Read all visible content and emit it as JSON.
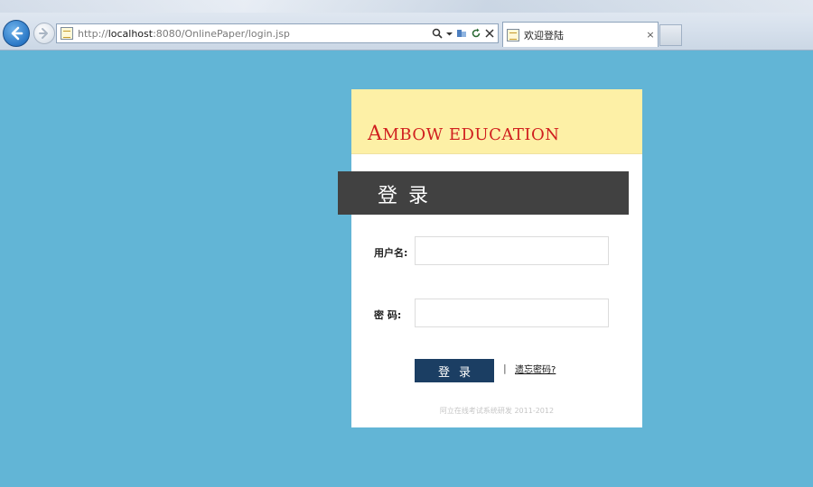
{
  "browser": {
    "url_prefix": "http://",
    "url_host": "localhost",
    "url_path": ":8080/OnlinePaper/login.jsp",
    "search_icon": "search-icon",
    "tab_title": "欢迎登陆",
    "tab_close": "×"
  },
  "card": {
    "brand_initial": "A",
    "brand_rest": "MBOW EDUCATION",
    "title": "登录",
    "username_label": "用户名:",
    "password_label": "密  码:",
    "username_value": "",
    "password_value": "",
    "login_button": "登录",
    "separator": "|",
    "forgot_link": "遗忘密码?",
    "copyright": "阿立在线考试系统研发 2011-2012"
  },
  "colors": {
    "page_background": "#62b5d6",
    "header_background": "#fdf0a6",
    "brand_red": "#d01f1f",
    "title_bar": "#414141",
    "login_button": "#1b3e63"
  }
}
